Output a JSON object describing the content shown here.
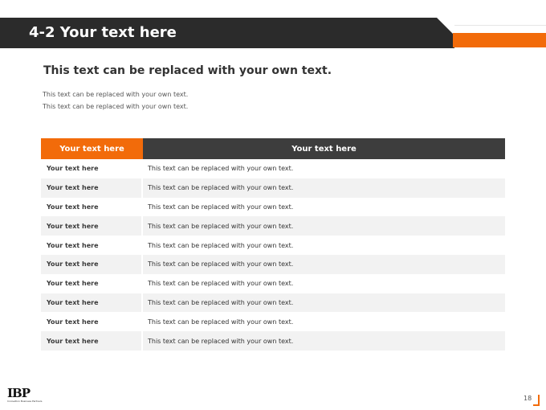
{
  "header": {
    "title": "4-2 Your text here"
  },
  "subtitle": "This text can be replaced with your own text.",
  "body_lines": [
    "This text can be replaced with your own text.",
    "This text can be replaced with your own text."
  ],
  "table": {
    "headers": [
      "Your text here",
      "Your text here"
    ],
    "rows": [
      [
        "Your text here",
        "This text can be replaced with your own text."
      ],
      [
        "Your text here",
        "This text can be replaced with your own text."
      ],
      [
        "Your text here",
        "This text can be replaced with your own text."
      ],
      [
        "Your text here",
        "This text can be replaced with your own text."
      ],
      [
        "Your text here",
        "This text can be replaced with your own text."
      ],
      [
        "Your text here",
        "This text can be replaced with your own text."
      ],
      [
        "Your text here",
        "This text can be replaced with your own text."
      ],
      [
        "Your text here",
        "This text can be replaced with your own text."
      ],
      [
        "Your text here",
        "This text can be replaced with your own text."
      ],
      [
        "Your text here",
        "This text can be replaced with your own text."
      ]
    ]
  },
  "footer": {
    "logo_text": "IBP",
    "logo_subtext": "Innovation Business Partners",
    "page_number": "18"
  },
  "colors": {
    "accent": "#f26b0a",
    "dark": "#2b2b2b",
    "header_dark": "#3d3d3d",
    "row_alt": "#f2f2f2"
  }
}
